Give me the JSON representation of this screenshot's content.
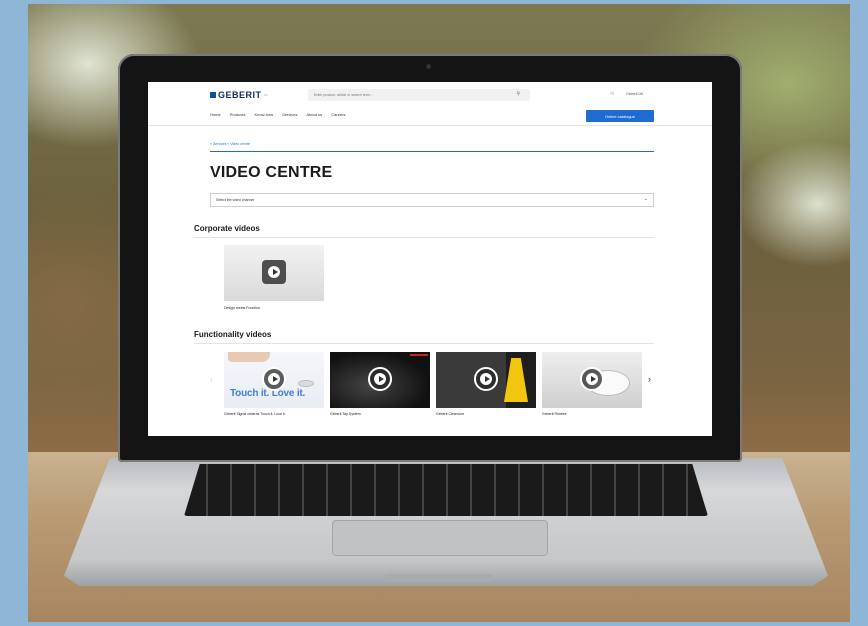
{
  "site": {
    "logo": "GEBERIT",
    "logo_tm": "™",
    "search_placeholder": "Enter product, article or search term...",
    "country": "Geberit UK",
    "nav": [
      "Home",
      "Products",
      "Know-how",
      "Services",
      "About us",
      "Careers"
    ],
    "catalogue_button": "Online catalogue"
  },
  "page": {
    "breadcrumb": "« Services » Video centre",
    "title": "VIDEO CENTRE",
    "channel_select": "Select the video channel"
  },
  "sections": {
    "corporate": {
      "title": "Corporate videos",
      "videos": [
        {
          "caption": "Design meets Function"
        }
      ]
    },
    "functionality": {
      "title": "Functionality videos",
      "videos": [
        {
          "caption": "Geberit Sigma cisterns Touch it. Love it.",
          "overlay_text": "Touch it. Love it."
        },
        {
          "caption": "Geberit Tap System"
        },
        {
          "caption": "Geberit CleanLine"
        },
        {
          "caption": "Geberit Rimfree"
        }
      ]
    }
  },
  "icons": {
    "play": "play-icon",
    "search": "search-icon",
    "globe": "globe-icon",
    "chevron": "chevron-down-icon",
    "next": "chevron-right-icon",
    "prev": "chevron-left-icon"
  },
  "colors": {
    "brand": "#0f2c5c",
    "accent": "#1f6bd0"
  }
}
